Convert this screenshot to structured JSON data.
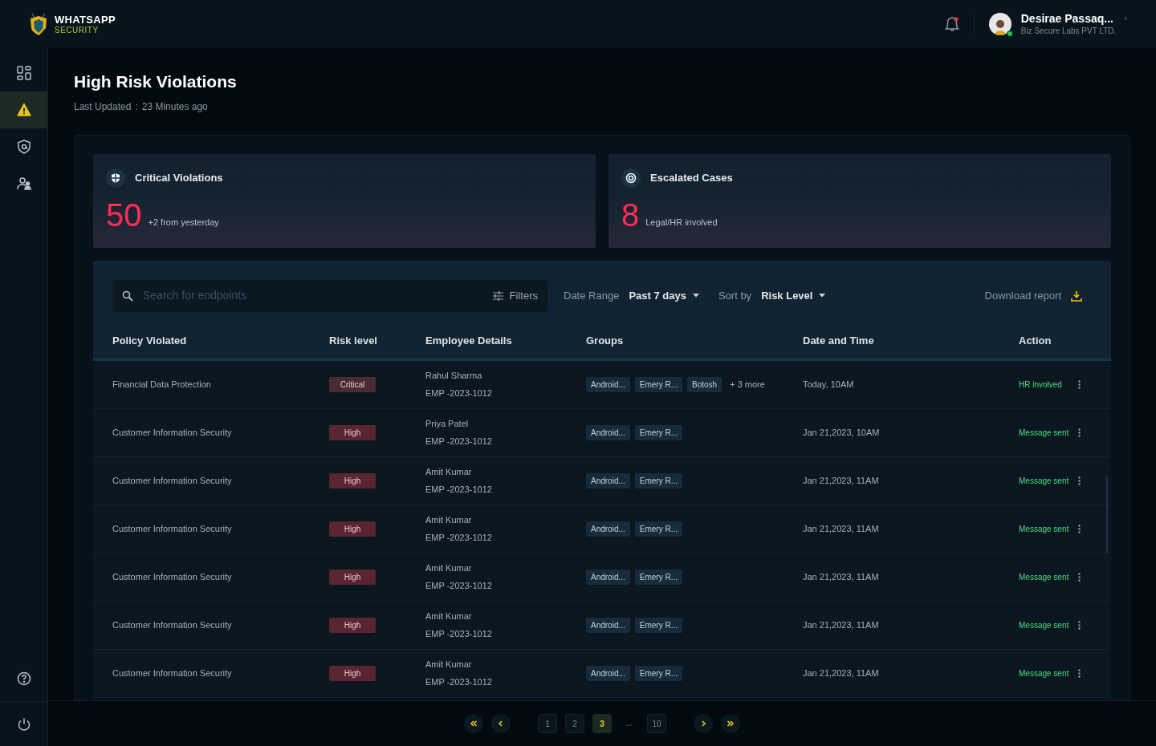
{
  "brand": {
    "name": "WHATSAPP",
    "tagline": "SECURITY"
  },
  "header": {
    "notifications_unread": true,
    "user": {
      "name": "Desirae Passaq...",
      "company": "Biz Secure Labs PVT LTD.",
      "online": true,
      "chevron": "›"
    }
  },
  "sidebar": {
    "items": [
      {
        "kind": "dashboard",
        "selected": false
      },
      {
        "kind": "alert",
        "selected": true
      },
      {
        "kind": "shield",
        "selected": false
      },
      {
        "kind": "users",
        "selected": false
      }
    ],
    "bottom": [
      {
        "kind": "help"
      },
      {
        "kind": "power"
      }
    ]
  },
  "page": {
    "title": "High Risk Violations",
    "updated_label": "Last Updated",
    "separator": ":",
    "updated_value": "23 Minutes ago"
  },
  "stats": [
    {
      "kind": "shield",
      "title": "Critical Violations",
      "value": "50",
      "note": "+2 from yesterday"
    },
    {
      "kind": "target",
      "title": "Escalated Cases",
      "value": "8",
      "note": "Legal/HR involved"
    }
  ],
  "toolbar": {
    "search": {
      "placeholder": "Search for endpoints"
    },
    "filters": "Filters",
    "date_range": {
      "label": "Date Range",
      "value": "Past 7 days"
    },
    "sort": {
      "label": "Sort by",
      "value": "Risk Level"
    },
    "download": "Download report"
  },
  "table": {
    "columns": [
      "Policy Violated",
      "Risk level",
      "Employee Details",
      "Groups",
      "Date and Time",
      "Action"
    ],
    "rows": [
      {
        "policy": "Financial Data Protection",
        "risk": {
          "label": "Critical",
          "kind": "critical"
        },
        "name": "Rahul Sharma",
        "emp_id": "EMP -2023-1012",
        "groups": [
          "Android...",
          "Emery R...",
          "Botosh"
        ],
        "more": "+ 3 more",
        "date": "Today, 10AM",
        "action": "HR involved"
      },
      {
        "policy": "Customer Information Security",
        "risk": {
          "label": "High",
          "kind": "high"
        },
        "name": "Priya Patel",
        "emp_id": "EMP -2023-1012",
        "groups": [
          "Android...",
          "Emery R..."
        ],
        "date": "Jan 21,2023, 10AM",
        "action": "Message sent"
      },
      {
        "policy": "Customer Information Security",
        "risk": {
          "label": "High",
          "kind": "high"
        },
        "name": "Amit Kumar",
        "emp_id": "EMP -2023-1012",
        "groups": [
          "Android...",
          "Emery R..."
        ],
        "date": "Jan 21,2023, 11AM",
        "action": "Message sent"
      },
      {
        "policy": "Customer Information Security",
        "risk": {
          "label": "High",
          "kind": "high"
        },
        "name": "Amit Kumar",
        "emp_id": "EMP -2023-1012",
        "groups": [
          "Android...",
          "Emery R..."
        ],
        "date": "Jan 21,2023, 11AM",
        "action": "Message sent"
      },
      {
        "policy": "Customer Information Security",
        "risk": {
          "label": "High",
          "kind": "high"
        },
        "name": "Amit Kumar",
        "emp_id": "EMP -2023-1012",
        "groups": [
          "Android...",
          "Emery R..."
        ],
        "date": "Jan 21,2023, 11AM",
        "action": "Message sent"
      },
      {
        "policy": "Customer Information Security",
        "risk": {
          "label": "High",
          "kind": "high"
        },
        "name": "Amit Kumar",
        "emp_id": "EMP -2023-1012",
        "groups": [
          "Android...",
          "Emery R..."
        ],
        "date": "Jan 21,2023, 11AM",
        "action": "Message sent"
      },
      {
        "policy": "Customer Information Security",
        "risk": {
          "label": "High",
          "kind": "high"
        },
        "name": "Amit Kumar",
        "emp_id": "EMP -2023-1012",
        "groups": [
          "Android...",
          "Emery R..."
        ],
        "date": "Jan 21,2023, 11AM",
        "action": "Message sent"
      }
    ]
  },
  "pagination": {
    "pages": [
      {
        "label": "1",
        "selected": false
      },
      {
        "label": "2",
        "selected": false
      },
      {
        "label": "3",
        "selected": true
      },
      {
        "label": "...",
        "kind": "gap",
        "selected": false
      },
      {
        "label": "10",
        "selected": false
      }
    ]
  }
}
